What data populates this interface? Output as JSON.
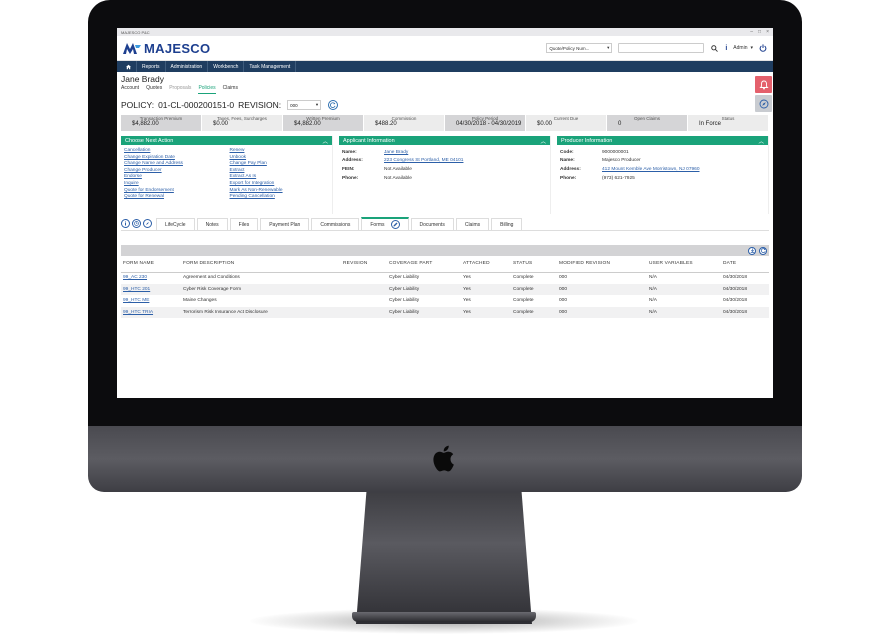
{
  "window": {
    "title": "MAJESCO P&C"
  },
  "brand": {
    "name": "MAJESCO",
    "color": "#1d3f8f",
    "accent": "#1aa37a",
    "nav_bg": "#1f3d60"
  },
  "header": {
    "quote_policy_select": "Quote/Policy Num...",
    "user": "Admin"
  },
  "nav": {
    "items": [
      "Reports",
      "Administration",
      "Workbench",
      "Task Management"
    ]
  },
  "customer": {
    "name": "Jane Brady"
  },
  "subtabs": [
    "Account",
    "Quotes",
    "Proposals",
    "Policies",
    "Claims"
  ],
  "policy": {
    "label": "POLICY:",
    "number": "01-CL-000200151-0",
    "revision_label": "REVISION:",
    "revision_value": "000"
  },
  "summary": [
    {
      "label": "Transaction Premium",
      "value": "$4,882.00"
    },
    {
      "label": "Taxes, Fees, Surcharges",
      "value": "$0.00"
    },
    {
      "label": "Written Premium",
      "value": "$4,882.00"
    },
    {
      "label": "Commission",
      "value": "$488.20"
    },
    {
      "label": "Policy Period",
      "value": "04/30/2018 - 04/30/2019"
    },
    {
      "label": "Current Due",
      "value": "$0.00"
    },
    {
      "label": "Open Claims",
      "value": "0"
    },
    {
      "label": "Status",
      "value": "In Force"
    }
  ],
  "next_action": {
    "title": "Choose Next Action",
    "left": [
      "Cancellation",
      "Change Expiration Date",
      "Change Name and Address",
      "Change Producer",
      "Endorse",
      "Inquire",
      "Quote for Endorsement",
      "Quote for Renewal"
    ],
    "right": [
      "Renew",
      "Unbook",
      "Change Pay Plan",
      "Extract",
      "Extract As Is",
      "Export for Integration",
      "Mark As Non-Renewable",
      "Pending Cancellation"
    ]
  },
  "applicant": {
    "title": "Applicant Information",
    "rows": [
      {
        "k": "Name:",
        "v": "Jane Brady",
        "link": true
      },
      {
        "k": "Address:",
        "v": "223 Congress St Portland, ME 04101",
        "link": true
      },
      {
        "k": "FEIN:",
        "v": "Not Available",
        "link": false
      },
      {
        "k": "Phone:",
        "v": "Not Available",
        "link": false
      }
    ]
  },
  "producer": {
    "title": "Producer Information",
    "rows": [
      {
        "k": "Code:",
        "v": "9000000001",
        "link": false
      },
      {
        "k": "Name:",
        "v": "Majesco Producer",
        "link": false
      },
      {
        "k": "Address:",
        "v": "412 Mount Kemble Ave Morristown, NJ 07960",
        "link": true
      },
      {
        "k": "Phone:",
        "v": "(973) 621-7925",
        "link": false
      }
    ]
  },
  "tabs": [
    "LifeCycle",
    "Notes",
    "Files",
    "Payment Plan",
    "Commissions",
    "Forms",
    "Documents",
    "Claims",
    "Billing"
  ],
  "active_tab": "Forms",
  "forms_table": {
    "headers": [
      "FORM NAME",
      "FORM DESCRIPTION",
      "REVISION",
      "COVERAGE PART",
      "ATTACHED",
      "STATUS",
      "MODIFIED REVISION",
      "USER VARIABLES",
      "DATE"
    ],
    "rows": [
      [
        "99_AC 230",
        "Agreement and Conditions",
        "",
        "Cyber Liability",
        "Yes",
        "Complete",
        "000",
        "N/A",
        "04/30/2018"
      ],
      [
        "99_HTC 201",
        "Cyber Risk Coverage Form",
        "",
        "Cyber Liability",
        "Yes",
        "Complete",
        "000",
        "N/A",
        "04/30/2018"
      ],
      [
        "99_HTC ME",
        "Maine Changes",
        "",
        "Cyber Liability",
        "Yes",
        "Complete",
        "000",
        "N/A",
        "04/30/2018"
      ],
      [
        "99_HTC TRIA",
        "Terrorism Risk Insurance Act Disclosure",
        "",
        "Cyber Liability",
        "Yes",
        "Complete",
        "000",
        "N/A",
        "04/30/2018"
      ]
    ]
  },
  "icons": [
    "home-icon",
    "search-icon",
    "info-icon",
    "logout-icon",
    "refresh-icon",
    "collapse-icon",
    "download-icon",
    "edit-icon"
  ]
}
